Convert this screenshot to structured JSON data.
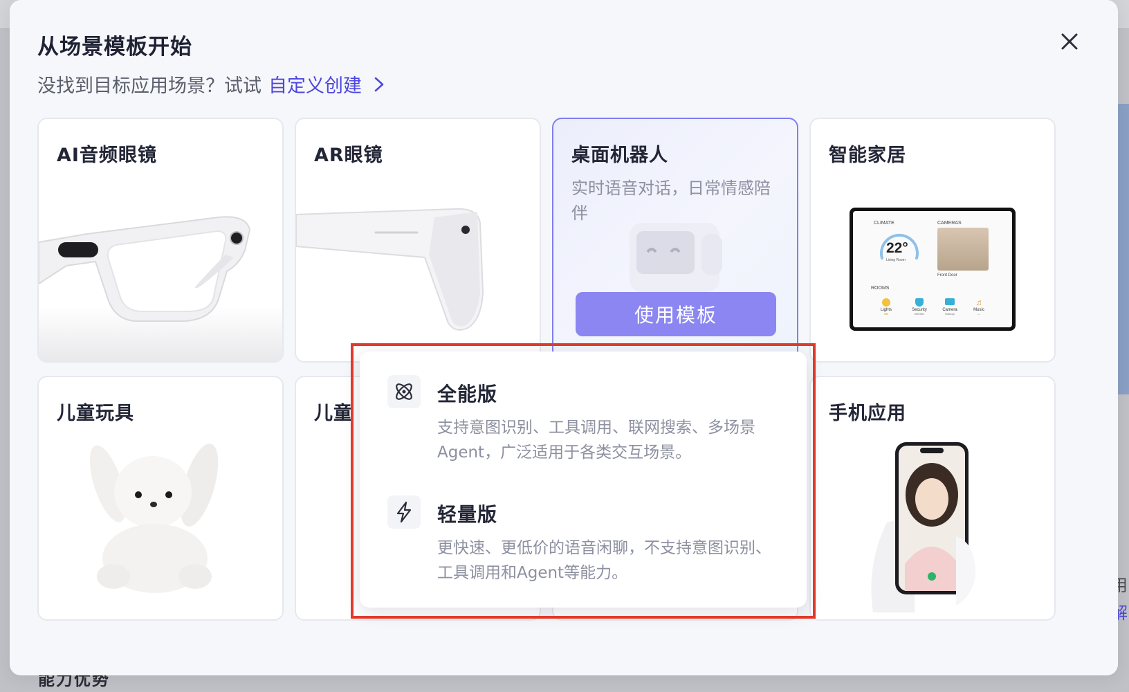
{
  "background": {
    "bottom_text": "能力优势",
    "right_text_1": "用",
    "right_text_2": "了解"
  },
  "modal": {
    "title": "从场景模板开始",
    "subtitle_prefix": "没找到目标应用场景？试试",
    "subtitle_link": "自定义创建",
    "close_icon": "close-icon"
  },
  "cards": [
    {
      "title": "AI音频眼镜",
      "image": "smart-glasses-image"
    },
    {
      "title": "AR眼镜",
      "image": "ar-glasses-image"
    },
    {
      "title": "桌面机器人",
      "desc": "实时语音对话，日常情感陪伴",
      "button": "使用模板",
      "image": "desk-robot-image"
    },
    {
      "title": "智能家居",
      "image": "smart-home-tablet-image"
    },
    {
      "title": "儿童玩具",
      "image": "plush-bunny-image"
    },
    {
      "title": "儿童",
      "image": "partially-hidden"
    },
    {
      "title": "",
      "image": "speaker-image"
    },
    {
      "title": "手机应用",
      "image": "phone-app-image"
    }
  ],
  "tablet": {
    "climate_label": "CLIMATE",
    "cameras_label": "CAMERAS",
    "temperature": "22°",
    "temperature_sub": "Living Room",
    "camera_caption": "Front Door",
    "rooms_label": "ROOMS",
    "rooms": [
      {
        "label": "Lights",
        "status": "ON"
      },
      {
        "label": "Security",
        "status": "ARMED"
      },
      {
        "label": "Camera",
        "status": "Hallway"
      },
      {
        "label": "Music",
        "status": "—"
      }
    ]
  },
  "dropdown": {
    "options": [
      {
        "title": "全能版",
        "desc": "支持意图识别、工具调用、联网搜索、多场景Agent，广泛适用于各类交互场景。",
        "icon": "atom-icon"
      },
      {
        "title": "轻量版",
        "desc": "更快速、更低价的语音闲聊，不支持意图识别、工具调用和Agent等能力。",
        "icon": "lightning-icon"
      }
    ]
  },
  "colors": {
    "accent": "#4d46e0",
    "button": "#8b86f2",
    "highlight": "#e03a2b"
  }
}
